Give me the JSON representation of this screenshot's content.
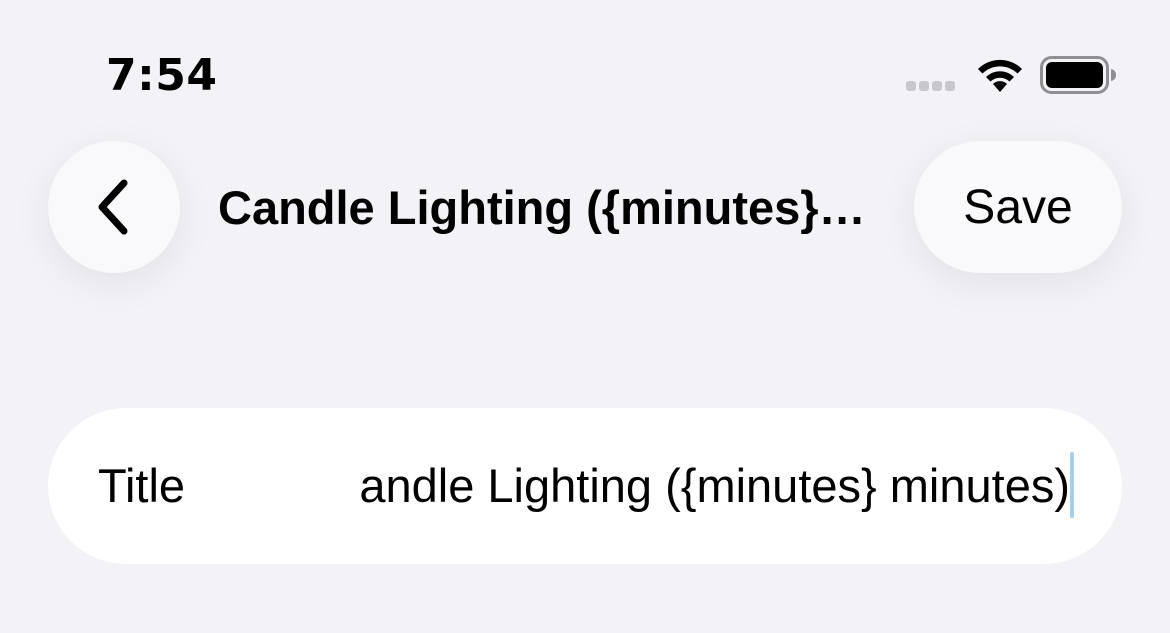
{
  "status_bar": {
    "time": "7:54"
  },
  "nav": {
    "title": "Candle Lighting ({minutes} minutes)",
    "save_label": "Save"
  },
  "form": {
    "title_label": "Title",
    "title_value": "Candle Lighting ({minutes} minutes)"
  },
  "colors": {
    "background": "#f2f2f7",
    "card": "#ffffff",
    "caret": "#a8cdf5"
  }
}
